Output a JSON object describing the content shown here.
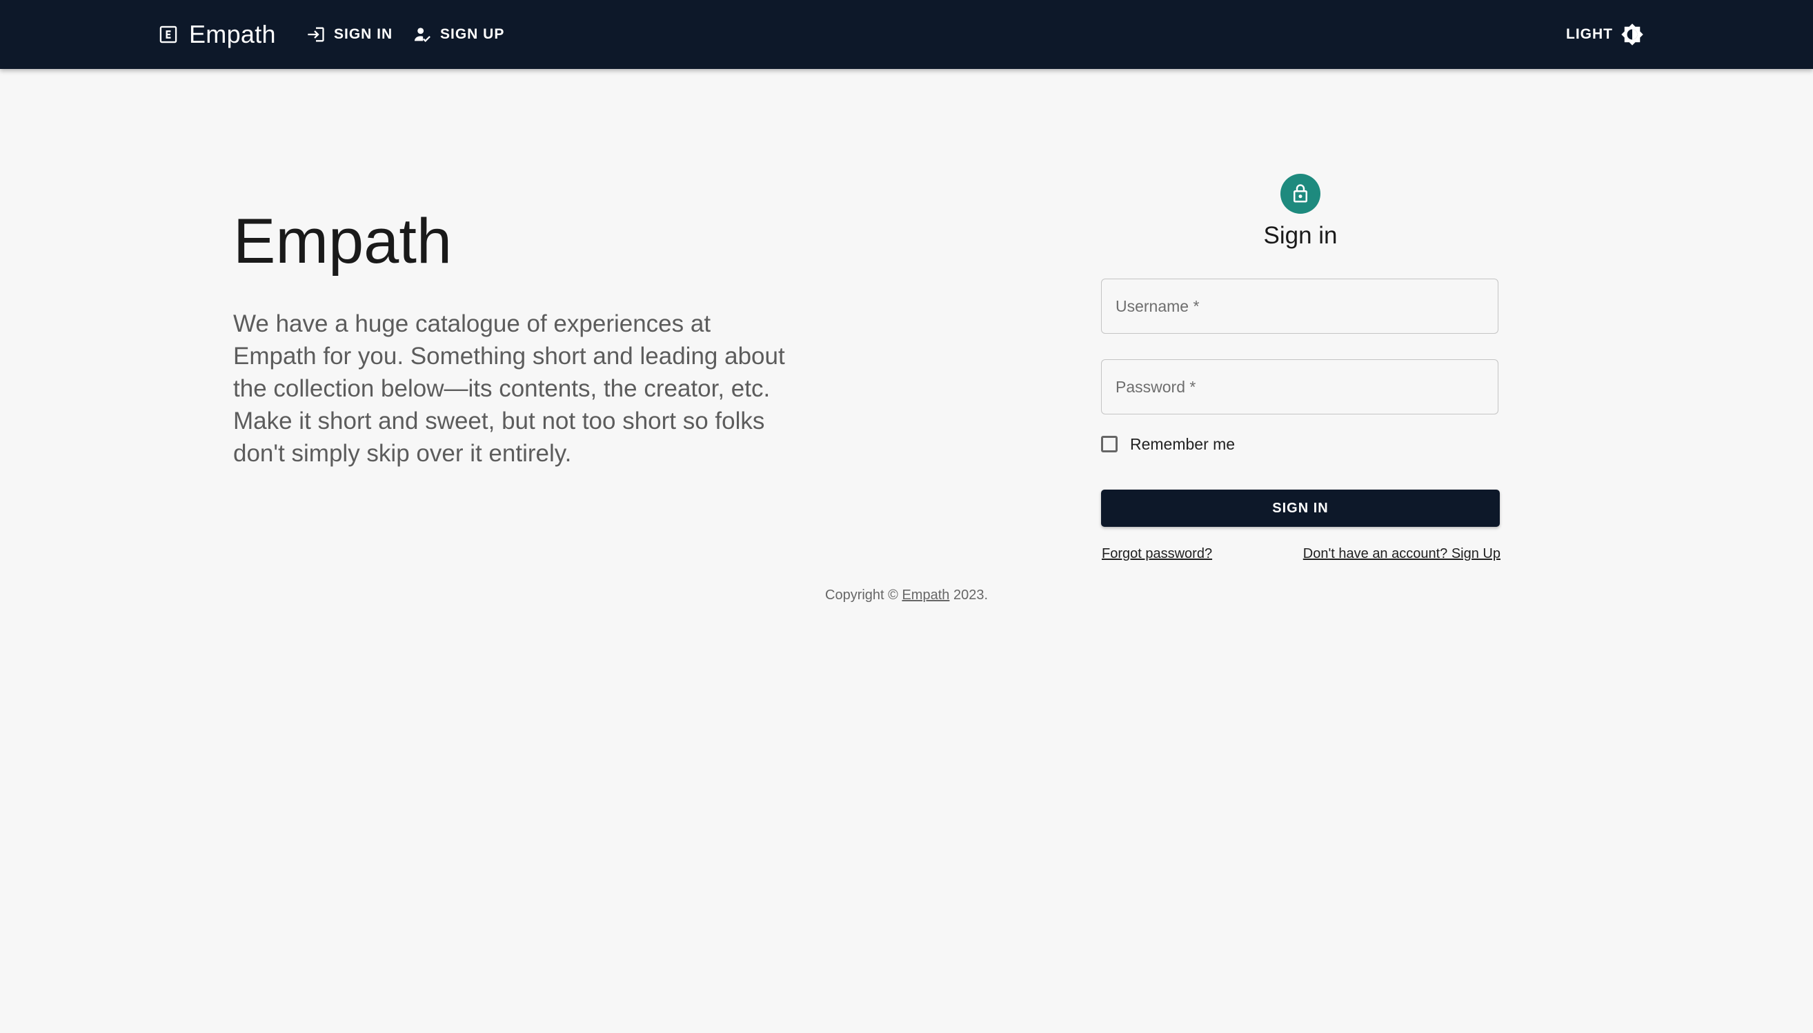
{
  "header": {
    "brand": "Empath",
    "brand_icon": "letter-e-box-icon",
    "nav": [
      {
        "label": "SIGN IN",
        "icon": "login-icon"
      },
      {
        "label": "SIGN UP",
        "icon": "person-add-icon"
      }
    ],
    "theme_label": "LIGHT",
    "theme_icon": "brightness-icon"
  },
  "hero": {
    "title": "Empath",
    "description": "We have a huge catalogue of experiences at Empath for you. Something short and leading about the collection below—its contents, the creator, etc. Make it short and sweet, but not too short so folks don't simply skip over it entirely."
  },
  "signin": {
    "icon": "lock-icon",
    "heading": "Sign in",
    "username_placeholder": "Username *",
    "password_placeholder": "Password *",
    "remember_label": "Remember me",
    "submit_label": "SIGN IN",
    "forgot_label": "Forgot password?",
    "signup_label": "Don't have an account? Sign Up"
  },
  "footer": {
    "prefix": "Copyright © ",
    "link": "Empath",
    "suffix": " 2023."
  },
  "colors": {
    "appbar": "#0d1829",
    "accent": "#1e8a7e",
    "background": "#f7f7f7"
  }
}
